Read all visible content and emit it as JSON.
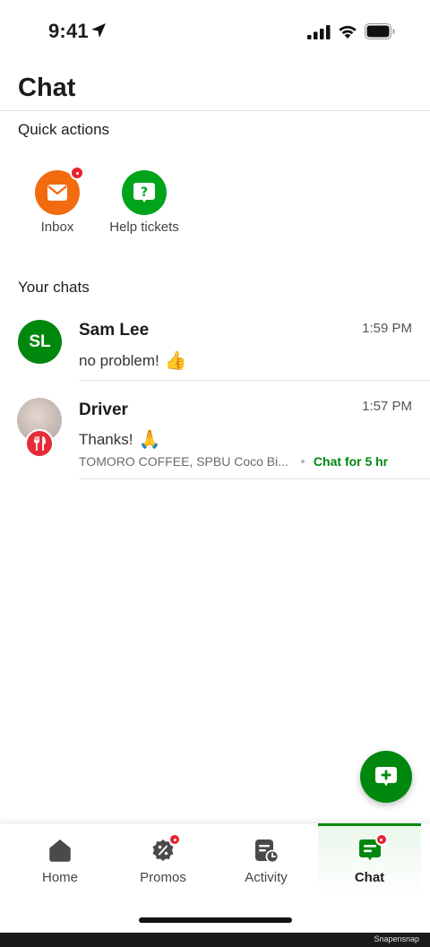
{
  "status_bar": {
    "time": "9:41",
    "icons": [
      "location-arrow-icon",
      "signal-icon",
      "wifi-icon",
      "battery-icon"
    ]
  },
  "page": {
    "title": "Chat"
  },
  "quick_actions": {
    "heading": "Quick actions",
    "items": [
      {
        "label": "Inbox",
        "icon": "mail-icon",
        "color": "#f26b0f",
        "has_badge": true
      },
      {
        "label": "Help tickets",
        "icon": "help-bubble-icon",
        "color": "#00a41a",
        "has_badge": false
      }
    ]
  },
  "chats": {
    "heading": "Your chats",
    "items": [
      {
        "initials": "SL",
        "name": "Sam Lee",
        "time": "1:59 PM",
        "message": "no problem!",
        "emoji": "👍"
      },
      {
        "name": "Driver",
        "time": "1:57 PM",
        "message": "Thanks!",
        "emoji": "🙏",
        "merchant": "TOMORO COFFEE, SPBU Coco Bi...",
        "duration": "Chat for 5 hr",
        "badge_icon": "fork-knife-icon"
      }
    ]
  },
  "fab": {
    "icon": "new-chat-icon"
  },
  "bottom_nav": {
    "items": [
      {
        "label": "Home",
        "icon": "home-icon",
        "active": false,
        "has_badge": false
      },
      {
        "label": "Promos",
        "icon": "promo-icon",
        "active": false,
        "has_badge": true
      },
      {
        "label": "Activity",
        "icon": "activity-icon",
        "active": false,
        "has_badge": false
      },
      {
        "label": "Chat",
        "icon": "chat-icon",
        "active": true,
        "has_badge": true
      }
    ]
  },
  "colors": {
    "brand_green": "#00880e",
    "inbox_orange": "#f26b0f",
    "help_green": "#00a41a",
    "badge_red": "#e8212f",
    "food_red": "#e42c3a"
  },
  "watermark": "Snapensnap"
}
